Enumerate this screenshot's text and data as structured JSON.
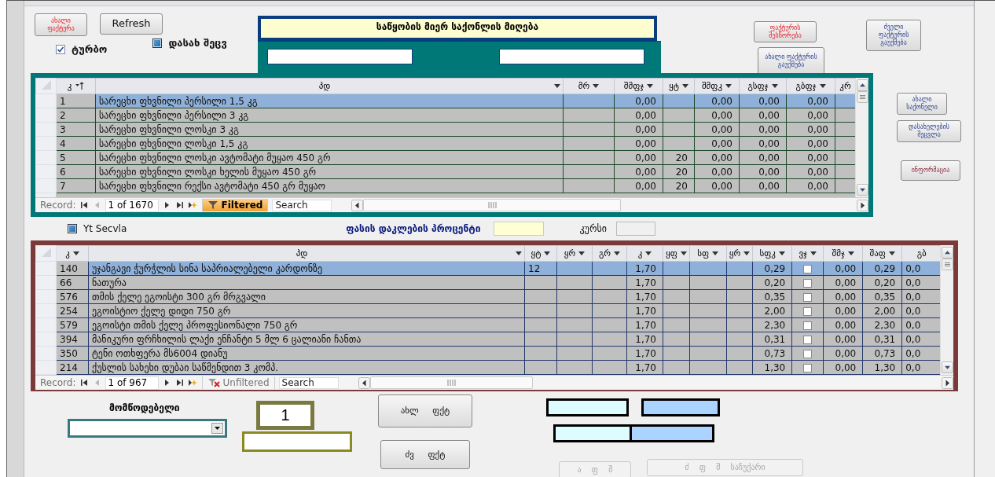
{
  "top_buttons": [
    {
      "label": "ახალი ფაქტურა",
      "kind": "alert"
    },
    {
      "label": "Refresh",
      "kind": "plain"
    }
  ],
  "title": "საწყობის მიერ საქონლის მიღება",
  "turbo": {
    "label": "ტურბო",
    "checked": true
  },
  "rename": {
    "label": "დასახ შეცვ",
    "checked": false
  },
  "invoice_buttons": [
    {
      "label": "ფაქტურის შესწორება",
      "kind": "alert"
    },
    {
      "label": "ძველი ფაქტურის გაუქმება",
      "kind": "info"
    },
    {
      "label": "ახალი ფაქტურის გაუქმება",
      "kind": "info"
    }
  ],
  "upper_table": {
    "columns": [
      {
        "label": "კ",
        "kind": "id",
        "sorted": true
      },
      {
        "label": "პდ",
        "kind": "text",
        "sorted": false
      },
      {
        "label": "მრ",
        "kind": "text",
        "sorted": false
      },
      {
        "label": "შმფჯ",
        "kind": "num",
        "sorted": false
      },
      {
        "label": "ყტ",
        "kind": "num",
        "sorted": false
      },
      {
        "label": "შმფკ",
        "kind": "num",
        "sorted": false
      },
      {
        "label": "გსფჯ",
        "kind": "num",
        "sorted": false
      },
      {
        "label": "გბფჯ",
        "kind": "num",
        "sorted": false
      },
      {
        "label": "კრ",
        "kind": "text",
        "sorted": false
      }
    ],
    "rows": [
      {
        "selected": true,
        "cells": [
          "1",
          "სარეცხი ფხვნილი პერსილი 1,5 კგ",
          null,
          "0,00",
          null,
          "0,00",
          "0,00",
          "0,00",
          null
        ]
      },
      {
        "selected": false,
        "cells": [
          "2",
          "სარეცხი ფხვნილი პერსილი 3 კგ",
          null,
          "0,00",
          null,
          "0,00",
          "0,00",
          "0,00",
          null
        ]
      },
      {
        "selected": false,
        "cells": [
          "3",
          "სარეცხი ფხვნილი ლოსკი 3 კგ",
          null,
          "0,00",
          null,
          "0,00",
          "0,00",
          "0,00",
          null
        ]
      },
      {
        "selected": false,
        "cells": [
          "4",
          "სარეცხი ფხვნილი ლოსკი 1,5 კგ",
          null,
          "0,00",
          null,
          "0,00",
          "0,00",
          "0,00",
          null
        ]
      },
      {
        "selected": false,
        "cells": [
          "5",
          "სარეცხი ფხვნილი ლოსკი ავტომატი მუყაო 450 გრ",
          null,
          "0,00",
          "20",
          "0,00",
          "0,00",
          "0,00",
          null
        ]
      },
      {
        "selected": false,
        "cells": [
          "6",
          "სარეცხი ფხვნილი ლოსკი ხელის მუყაო 450 გრ",
          null,
          "0,00",
          "20",
          "0,00",
          "0,00",
          "0,00",
          null
        ]
      },
      {
        "selected": false,
        "cells": [
          "7",
          "სარეცხი ფხვნილი რექსი ავტომატი 450 გრ მუყაო",
          null,
          "0,00",
          "20",
          "0,00",
          "0,00",
          "0,00",
          null
        ]
      }
    ],
    "nav": {
      "record_label": "Record:",
      "position": "1 of 1670",
      "filter": "Filtered",
      "filter_active": true,
      "search_placeholder": "Search"
    }
  },
  "side_buttons": [
    {
      "label": "ახალი საქონელი",
      "kind": "info"
    },
    {
      "label": "დასახელების შეცვლა",
      "kind": "info"
    },
    {
      "label": "ინფორმაცია",
      "kind": "muted"
    }
  ],
  "yt_secvla": {
    "label": "Yt Secvla",
    "checked": false
  },
  "discount": {
    "label": "ფასის დაკლების პროცენტი"
  },
  "rate": {
    "label": "კურსი"
  },
  "lower_table": {
    "columns": [
      {
        "label": "კ",
        "kind": "id",
        "sorted": false
      },
      {
        "label": "პდ",
        "kind": "text",
        "sorted": false
      },
      {
        "label": "ყტ",
        "kind": "text",
        "sorted": false
      },
      {
        "label": "ყრ",
        "kind": "text",
        "sorted": false
      },
      {
        "label": "გრ",
        "kind": "text",
        "sorted": false
      },
      {
        "label": "კ",
        "kind": "num",
        "sorted": false
      },
      {
        "label": "ყფ",
        "kind": "text",
        "sorted": false
      },
      {
        "label": "სფ",
        "kind": "text",
        "sorted": false
      },
      {
        "label": "ყრ",
        "kind": "text",
        "sorted": false
      },
      {
        "label": "სფკ",
        "kind": "num",
        "sorted": false
      },
      {
        "label": "ვჯ",
        "kind": "check",
        "sorted": false
      },
      {
        "label": "შმჯ",
        "kind": "num",
        "sorted": false
      },
      {
        "label": "შაფ",
        "kind": "num",
        "sorted": false
      },
      {
        "label": "გბ",
        "kind": "num",
        "sorted": false
      }
    ],
    "rows": [
      {
        "selected": true,
        "checked": false,
        "cells": [
          "140",
          "უჯანგავი ჭურჭლის სინა საპრიალებელი კარდონზე",
          "12",
          null,
          null,
          "1,70",
          null,
          null,
          null,
          "0,29",
          null,
          "0,00",
          "0,29",
          "0,0"
        ]
      },
      {
        "selected": false,
        "checked": false,
        "cells": [
          "66",
          "ნათურა",
          null,
          null,
          null,
          "1,70",
          null,
          null,
          null,
          "0,20",
          null,
          "0,00",
          "0,20",
          "0,0"
        ]
      },
      {
        "selected": false,
        "checked": false,
        "cells": [
          "576",
          "თმის ქელე ეგოისტი 300 გრ მრგვალი",
          null,
          null,
          null,
          "1,70",
          null,
          null,
          null,
          "0,35",
          null,
          "0,00",
          "0,35",
          "0,0"
        ]
      },
      {
        "selected": false,
        "checked": false,
        "cells": [
          "254",
          "ეგოისტიო ქელე დიდი 750 გრ",
          null,
          null,
          null,
          "1,70",
          null,
          null,
          null,
          "2,00",
          null,
          "0,00",
          "2,00",
          "0,0"
        ]
      },
      {
        "selected": false,
        "checked": false,
        "cells": [
          "579",
          "ეგოისტი თმის ქელე პროფესიონალი 750 გრ",
          null,
          null,
          null,
          "1,70",
          null,
          null,
          null,
          "2,30",
          null,
          "0,00",
          "2,30",
          "0,0"
        ]
      },
      {
        "selected": false,
        "checked": false,
        "cells": [
          "394",
          "მანიკური ფრჩხილის ლაქი ენჩანტი 5 მლ 6 ცალიანი ჩანთა",
          null,
          null,
          null,
          "1,70",
          null,
          null,
          null,
          "0,31",
          null,
          "0,00",
          "0,31",
          "0,0"
        ]
      },
      {
        "selected": false,
        "checked": false,
        "cells": [
          "350",
          "ტენი ოთხფერა მს6004 დიანუ",
          null,
          null,
          null,
          "1,70",
          null,
          null,
          null,
          "0,73",
          null,
          "0,00",
          "0,73",
          "0,0"
        ]
      },
      {
        "selected": false,
        "checked": false,
        "cells": [
          "214",
          "ქუსლის სახეხი დუბაი საწმენდით 3 კომპ.",
          null,
          null,
          null,
          "1,70",
          null,
          null,
          null,
          "1,30",
          null,
          "0,00",
          "1,30",
          "0,0"
        ]
      }
    ],
    "nav": {
      "record_label": "Record:",
      "position": "1 of 967",
      "filter": "Unfiltered",
      "filter_active": false,
      "search_placeholder": "Search"
    }
  },
  "supplier": {
    "label": "მომწოდებელი"
  },
  "counter": "1",
  "invoice_nav_buttons": [
    {
      "label": "ახლ ფქტ"
    },
    {
      "label": "ძვ ფქტ"
    }
  ],
  "disabled_buttons": [
    {
      "label": "ა ფ შ",
      "disabled": true
    },
    {
      "label": "ძ ფ შ საჩუქარი",
      "disabled": true
    }
  ]
}
